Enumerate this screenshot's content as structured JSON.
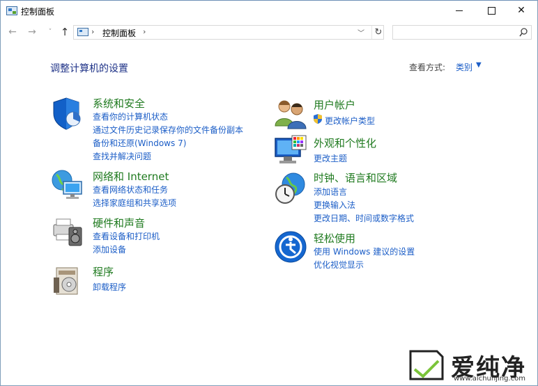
{
  "window": {
    "title": "控制面板",
    "minimize_symbol": "",
    "close_symbol": "✕"
  },
  "nav": {
    "back_icon": "←",
    "forward_icon": "→",
    "recent_icon": "˅",
    "up_icon": "↑",
    "address_sep": "›",
    "address_path": "控制面板",
    "dropdown_icon": "﹀",
    "refresh_icon": "↻",
    "search_placeholder": "",
    "search_icon": "⌕"
  },
  "main": {
    "heading": "调整计算机的设置",
    "view_by_label": "查看方式:",
    "view_by_value": "类别",
    "view_by_caret": "▼"
  },
  "categories_left": [
    {
      "icon": "system-security-icon",
      "title": "系统和安全",
      "links": [
        "查看你的计算机状态",
        "通过文件历史记录保存你的文件备份副本",
        "备份和还原(Windows 7)",
        "查找并解决问题"
      ]
    },
    {
      "icon": "network-internet-icon",
      "title": "网络和 Internet",
      "links": [
        "查看网络状态和任务",
        "选择家庭组和共享选项"
      ]
    },
    {
      "icon": "hardware-sound-icon",
      "title": "硬件和声音",
      "links": [
        "查看设备和打印机",
        "添加设备"
      ]
    },
    {
      "icon": "programs-icon",
      "title": "程序",
      "links": [
        "卸载程序"
      ]
    }
  ],
  "categories_right": [
    {
      "icon": "user-accounts-icon",
      "title": "用户帐户",
      "links": [
        "更改帐户类型"
      ]
    },
    {
      "icon": "appearance-personalization-icon",
      "title": "外观和个性化",
      "links": [
        "更改主题"
      ]
    },
    {
      "icon": "clock-language-region-icon",
      "title": "时钟、语言和区域",
      "links": [
        "添加语言",
        "更换输入法",
        "更改日期、时间或数字格式"
      ]
    },
    {
      "icon": "ease-of-access-icon",
      "title": "轻松使用",
      "links": [
        "使用 Windows 建议的设置",
        "优化视觉显示"
      ]
    }
  ],
  "watermark": {
    "text": "爱纯净",
    "url": "www.aichunjing.com"
  },
  "colors": {
    "link": "#1c5ec7",
    "category_title": "#1f7a1f",
    "heading": "#1e3287"
  }
}
